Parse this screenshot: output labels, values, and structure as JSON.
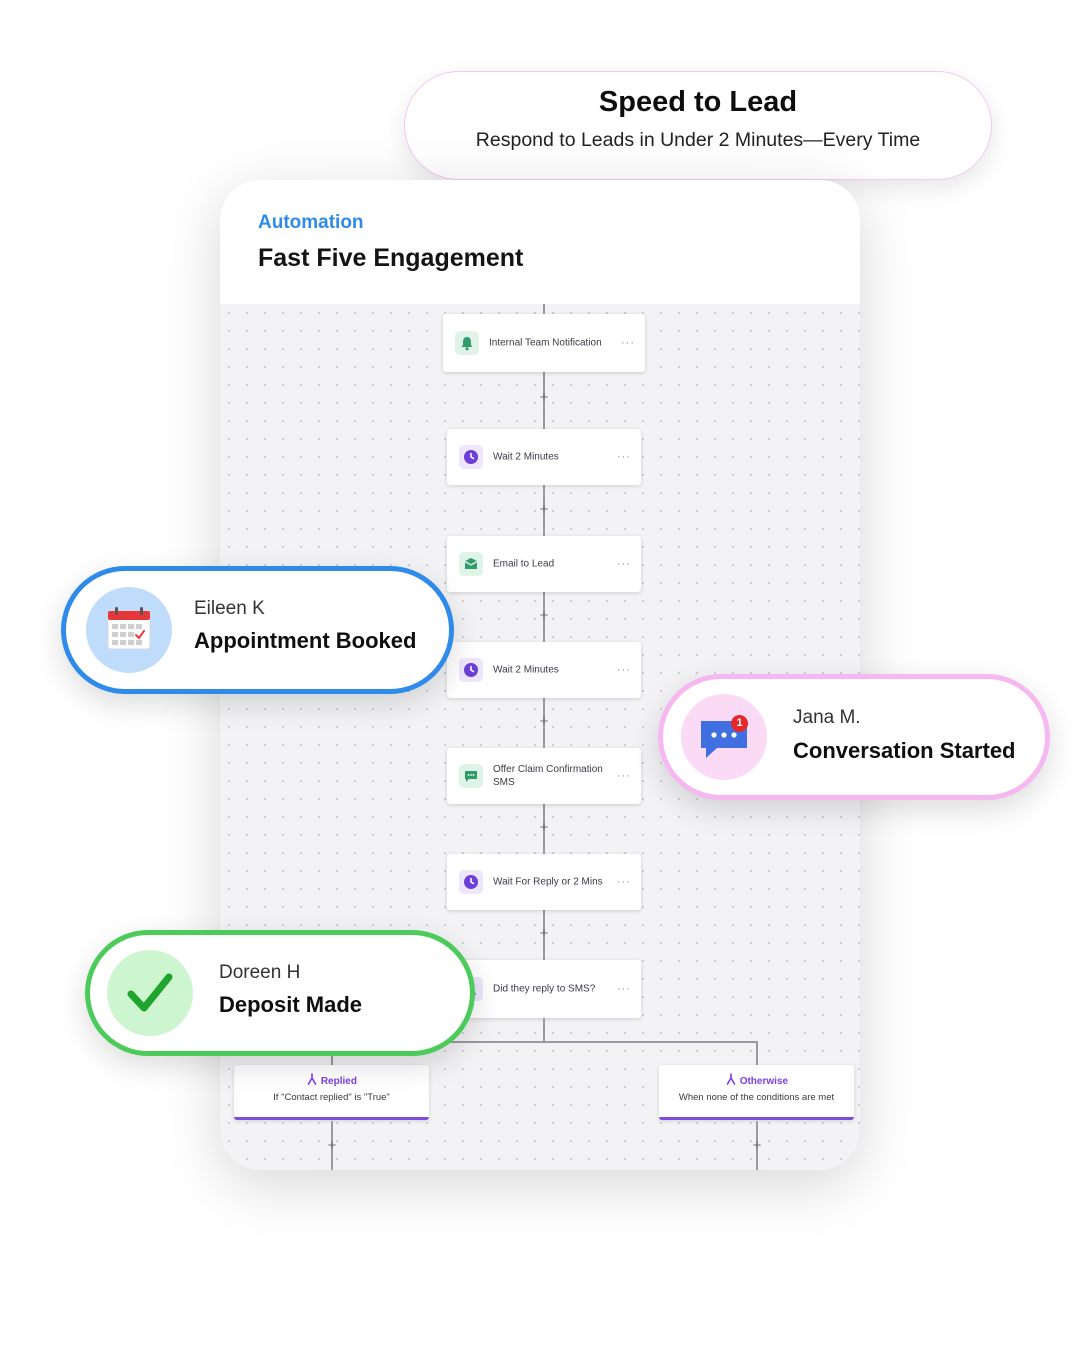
{
  "header": {
    "title": "Speed to Lead",
    "subtitle": "Respond to Leads in Under 2 Minutes—Every Time"
  },
  "card": {
    "eyebrow": "Automation",
    "title": "Fast Five Engagement"
  },
  "workflow": {
    "steps": [
      {
        "label": "Internal Team Notification",
        "icon": "bell-icon",
        "menu": "···"
      },
      {
        "label": "Wait 2 Minutes",
        "icon": "clock-icon",
        "menu": "···"
      },
      {
        "label": "Email to Lead",
        "icon": "envelope-icon",
        "menu": "···"
      },
      {
        "label": "Wait 2 Minutes",
        "icon": "clock-icon",
        "menu": "···"
      },
      {
        "label": "Offer Claim Confirmation SMS",
        "icon": "chat-icon",
        "menu": "···"
      },
      {
        "label": "Wait For Reply or 2 Mins",
        "icon": "clock-icon",
        "menu": "···"
      },
      {
        "label": "Did they reply to SMS?",
        "icon": "branch-icon",
        "menu": "···"
      }
    ],
    "add_symbol": "+",
    "branches": [
      {
        "title": "Replied",
        "description": "If \"Contact replied\" is \"True\""
      },
      {
        "title": "Otherwise",
        "description": "When none of the conditions are met"
      }
    ]
  },
  "notifications": [
    {
      "name": "Eileen K",
      "event": "Appointment Booked",
      "icon": "calendar-icon",
      "accent": "#2f8bea"
    },
    {
      "name": "Jana M.",
      "event": "Conversation Started",
      "icon": "message-bubble-icon",
      "badge": "1",
      "accent": "#f5b8f0"
    },
    {
      "name": "Doreen H",
      "event": "Deposit Made",
      "icon": "checkmark-icon",
      "accent": "#4ccb5a"
    }
  ],
  "colors": {
    "automation_blue": "#2f8bea",
    "branch_purple": "#7b3fe4",
    "success_green": "#4ccb5a",
    "pink_accent": "#f5b8f0"
  }
}
